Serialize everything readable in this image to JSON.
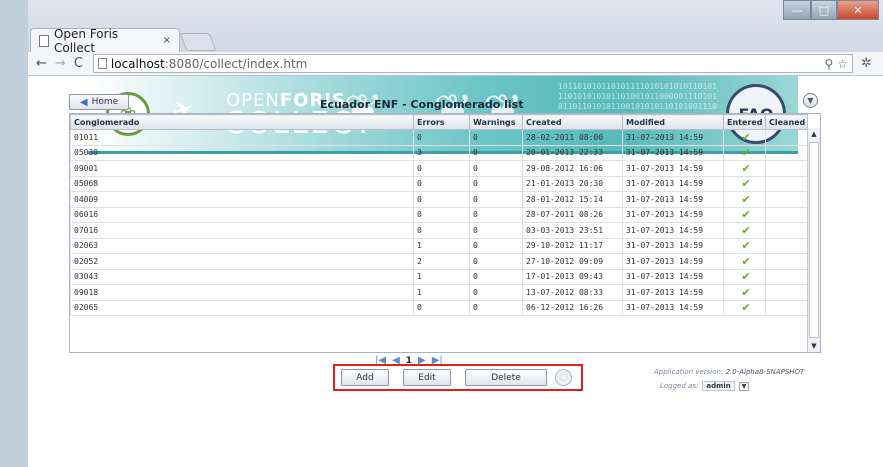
{
  "browser": {
    "tab_title": "Open Foris Collect",
    "tab_close": "×",
    "url_host": "localhost",
    "url_path": ":8080/collect/index.htm",
    "url_right_icons": "⚲ ☆"
  },
  "header": {
    "brand_top_light": "OPEN",
    "brand_top_bold": "FORIS",
    "brand_bottom": "COLLECT",
    "fao_text": "FAO",
    "binary_text": "1011010101101011110101010101101011101010101011010010110000011101010110110101011001010101101010011100110101011010110101011010"
  },
  "toolbar": {
    "home_label": "Home",
    "title": "Ecuador ENF - Conglomerado list"
  },
  "table": {
    "headers": [
      "Conglomerado",
      "Errors",
      "Warnings",
      "Created",
      "Modified",
      "Entered",
      "Cleaned"
    ],
    "rows": [
      [
        "01011",
        "0",
        "0",
        "28-02-2011 08:00",
        "31-07-2013 14:59",
        "✔",
        ""
      ],
      [
        "05030",
        "3",
        "0",
        "20-01-2013 22:33",
        "31-07-2013 14:59",
        "✔",
        ""
      ],
      [
        "09001",
        "0",
        "0",
        "29-08-2012 16:06",
        "31-07-2013 14:59",
        "✔",
        ""
      ],
      [
        "05068",
        "0",
        "0",
        "21-01-2013 20:30",
        "31-07-2013 14:59",
        "✔",
        ""
      ],
      [
        "04009",
        "0",
        "0",
        "28-01-2012 15:14",
        "31-07-2013 14:59",
        "✔",
        ""
      ],
      [
        "06016",
        "0",
        "0",
        "28-07-2011 08:26",
        "31-07-2013 14:59",
        "✔",
        ""
      ],
      [
        "07016",
        "0",
        "0",
        "03-03-2013 23:51",
        "31-07-2013 14:59",
        "✔",
        ""
      ],
      [
        "02063",
        "1",
        "0",
        "29-10-2012 11:17",
        "31-07-2013 14:59",
        "✔",
        ""
      ],
      [
        "02052",
        "2",
        "0",
        "27-10-2012 09:09",
        "31-07-2013 14:59",
        "✔",
        ""
      ],
      [
        "03043",
        "1",
        "0",
        "17-01-2013 09:43",
        "31-07-2013 14:59",
        "✔",
        ""
      ],
      [
        "09018",
        "1",
        "0",
        "13-07-2012 08:33",
        "31-07-2013 14:59",
        "✔",
        ""
      ],
      [
        "02065",
        "0",
        "0",
        "06-12-2012 16:26",
        "31-07-2013 14:59",
        "✔",
        ""
      ]
    ]
  },
  "pager": {
    "first": "|◀",
    "prev": "◀",
    "page": "1",
    "next": "▶",
    "last": "▶|"
  },
  "actions": {
    "add": "Add",
    "edit": "Edit",
    "delete": "Delete"
  },
  "footer": {
    "app_version_label": "Application version:",
    "app_version": "2.0-Alpha8-SNAPSHOT",
    "logged_as_label": "Logged as:",
    "user": "admin"
  },
  "colors": {
    "accent_red": "#e02020",
    "check_green": "#6aac2c",
    "banner_teal": "#57b9b9"
  }
}
